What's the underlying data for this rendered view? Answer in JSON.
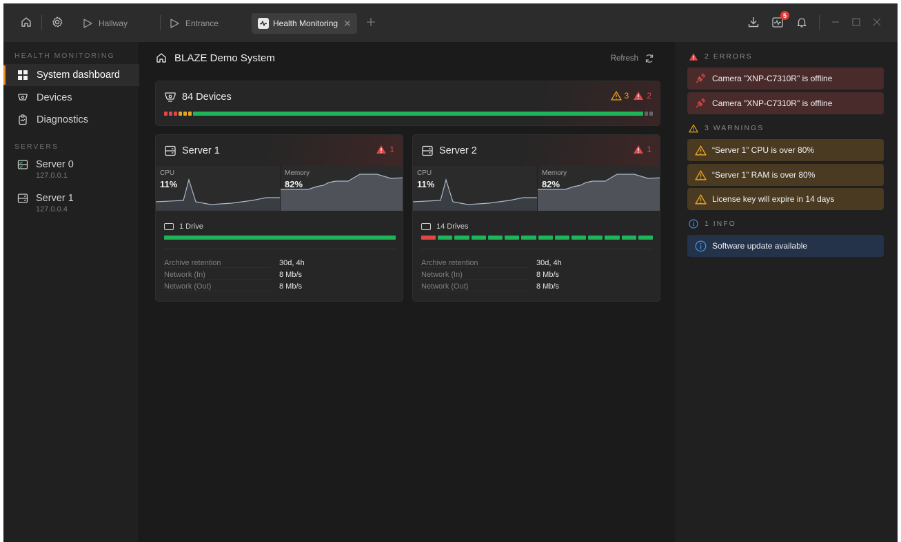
{
  "titlebar": {
    "tabs": [
      {
        "label": "Hallway"
      },
      {
        "label": "Entrance"
      },
      {
        "label": "Health Monitoring"
      }
    ],
    "notification_count": "5"
  },
  "sidebar": {
    "section_health": "HEALTH MONITORING",
    "items": [
      {
        "label": "System dashboard"
      },
      {
        "label": "Devices"
      },
      {
        "label": "Diagnostics"
      }
    ],
    "section_servers": "SERVERS",
    "servers": [
      {
        "name": "Server 0",
        "ip": "127.0.0.1"
      },
      {
        "name": "Server 1",
        "ip": "127.0.0.4"
      }
    ]
  },
  "main": {
    "title": "BLAZE Demo System",
    "refresh_label": "Refresh",
    "devices": {
      "title": "84 Devices",
      "warnings": "3",
      "errors": "2",
      "status_segments": {
        "error": 3,
        "warning": 3,
        "ok": 1,
        "offline": 2
      }
    },
    "servers": [
      {
        "title": "Server 1",
        "errors": "1",
        "cpu_label": "CPU",
        "cpu_value": "11%",
        "mem_label": "Memory",
        "mem_value": "82%",
        "drives_label": "1 Drive",
        "drives": [
          "ok"
        ],
        "stats": [
          {
            "key": "Archive retention",
            "value": "30d, 4h"
          },
          {
            "key": "Network (In)",
            "value": "8 Mb/s"
          },
          {
            "key": "Network (Out)",
            "value": "8 Mb/s"
          }
        ]
      },
      {
        "title": "Server 2",
        "errors": "1",
        "cpu_label": "CPU",
        "cpu_value": "11%",
        "mem_label": "Memory",
        "mem_value": "82%",
        "drives_label": "14 Drives",
        "drives": [
          "error",
          "ok",
          "ok",
          "ok",
          "ok",
          "ok",
          "ok",
          "ok",
          "ok",
          "ok",
          "ok",
          "ok",
          "ok",
          "ok"
        ],
        "stats": [
          {
            "key": "Archive retention",
            "value": "30d, 4h"
          },
          {
            "key": "Network (In)",
            "value": "8 Mb/s"
          },
          {
            "key": "Network (Out)",
            "value": "8 Mb/s"
          }
        ]
      }
    ]
  },
  "alerts": {
    "errors_header": "2 ERRORS",
    "errors": [
      {
        "text": "Camera \"XNP-C7310R\" is offline"
      },
      {
        "text": "Camera \"XNP-C7310R\" is offline"
      }
    ],
    "warnings_header": "3 WARNINGS",
    "warnings": [
      {
        "text": "“Server 1” CPU is over 80%"
      },
      {
        "text": "“Server 1” RAM is over 80%"
      },
      {
        "text": "License key will expire in 14 days"
      }
    ],
    "info_header": "1 INFO",
    "info": [
      {
        "text": "Software update available"
      }
    ]
  },
  "colors": {
    "accent": "#f18a23",
    "error": "#e04848",
    "warning": "#e5a424",
    "ok": "#1fb35a",
    "offline": "#666666",
    "info": "#3d8fe0"
  }
}
